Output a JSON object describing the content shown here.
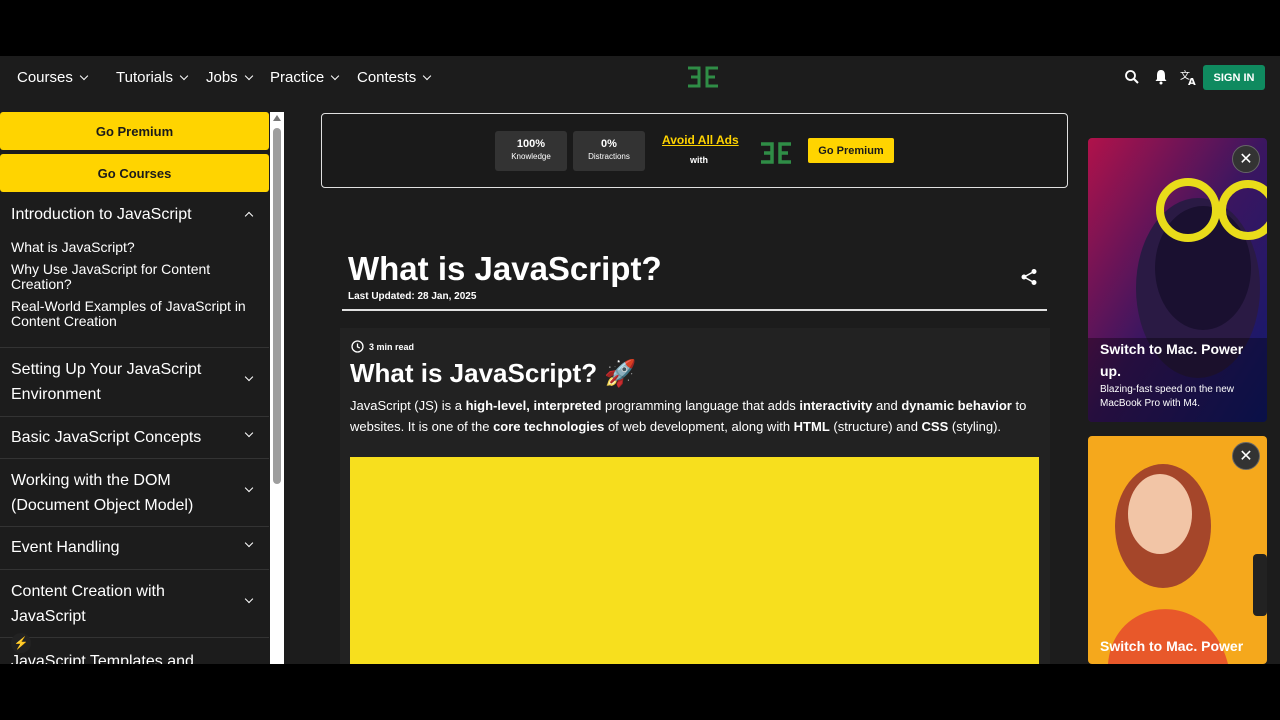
{
  "nav": {
    "items": [
      {
        "label": "Courses"
      },
      {
        "label": "Tutorials"
      },
      {
        "label": "Jobs"
      },
      {
        "label": "Practice"
      },
      {
        "label": "Contests"
      }
    ],
    "signin_label": "SIGN IN",
    "icons": [
      "search-icon",
      "bell-icon",
      "translate-icon"
    ],
    "logo_color": "#2f8d46"
  },
  "sidebar": {
    "premium_label": "Go Premium",
    "courses_label": "Go Courses",
    "sections": [
      {
        "title": "Introduction to JavaScript",
        "expanded": true,
        "items": [
          "What is JavaScript?",
          "Why Use JavaScript for Content Creation?",
          "Real-World Examples of JavaScript in Content Creation"
        ]
      },
      {
        "title": "Setting Up Your JavaScript Environment"
      },
      {
        "title": "Basic JavaScript Concepts"
      },
      {
        "title": "Working with the DOM (Document Object Model)"
      },
      {
        "title": "Event Handling"
      },
      {
        "title": "Content Creation with JavaScript"
      },
      {
        "title": "JavaScript Templates and"
      }
    ]
  },
  "banner": {
    "stat1_value": "100%",
    "stat1_label": "Knowledge",
    "stat2_value": "0%",
    "stat2_label": "Distractions",
    "avoid_label": "Avoid All Ads",
    "with_label": "with",
    "premium_label": "Go Premium"
  },
  "article": {
    "title": "What is JavaScript?",
    "updated": "Last Updated: 28 Jan, 2025",
    "read_time": "3 min read",
    "heading": "What is JavaScript? 🚀",
    "para": {
      "t1": "JavaScript (JS) is a ",
      "b1": "high-level, interpreted",
      "t2": " programming language that adds ",
      "b2": "interactivity",
      "t3": " and ",
      "b3": "dynamic behavior",
      "t4": " to websites. It is one of the ",
      "b4": "core technologies",
      "t5": " of web development, along with ",
      "b5": "HTML",
      "t6": " (structure) and ",
      "b6": "CSS",
      "t7": " (styling)."
    },
    "image_color": "#f7df1e"
  },
  "ads": {
    "ad1_heading": "Switch to Mac. Power up.",
    "ad1_sub": "Blazing-fast speed on the new MacBook Pro with M4.",
    "ad2_heading": "Switch to Mac. Power"
  },
  "colors": {
    "accent_yellow": "#ffd400",
    "signin_green": "#0f8a5f",
    "background": "#1c1c1c"
  }
}
